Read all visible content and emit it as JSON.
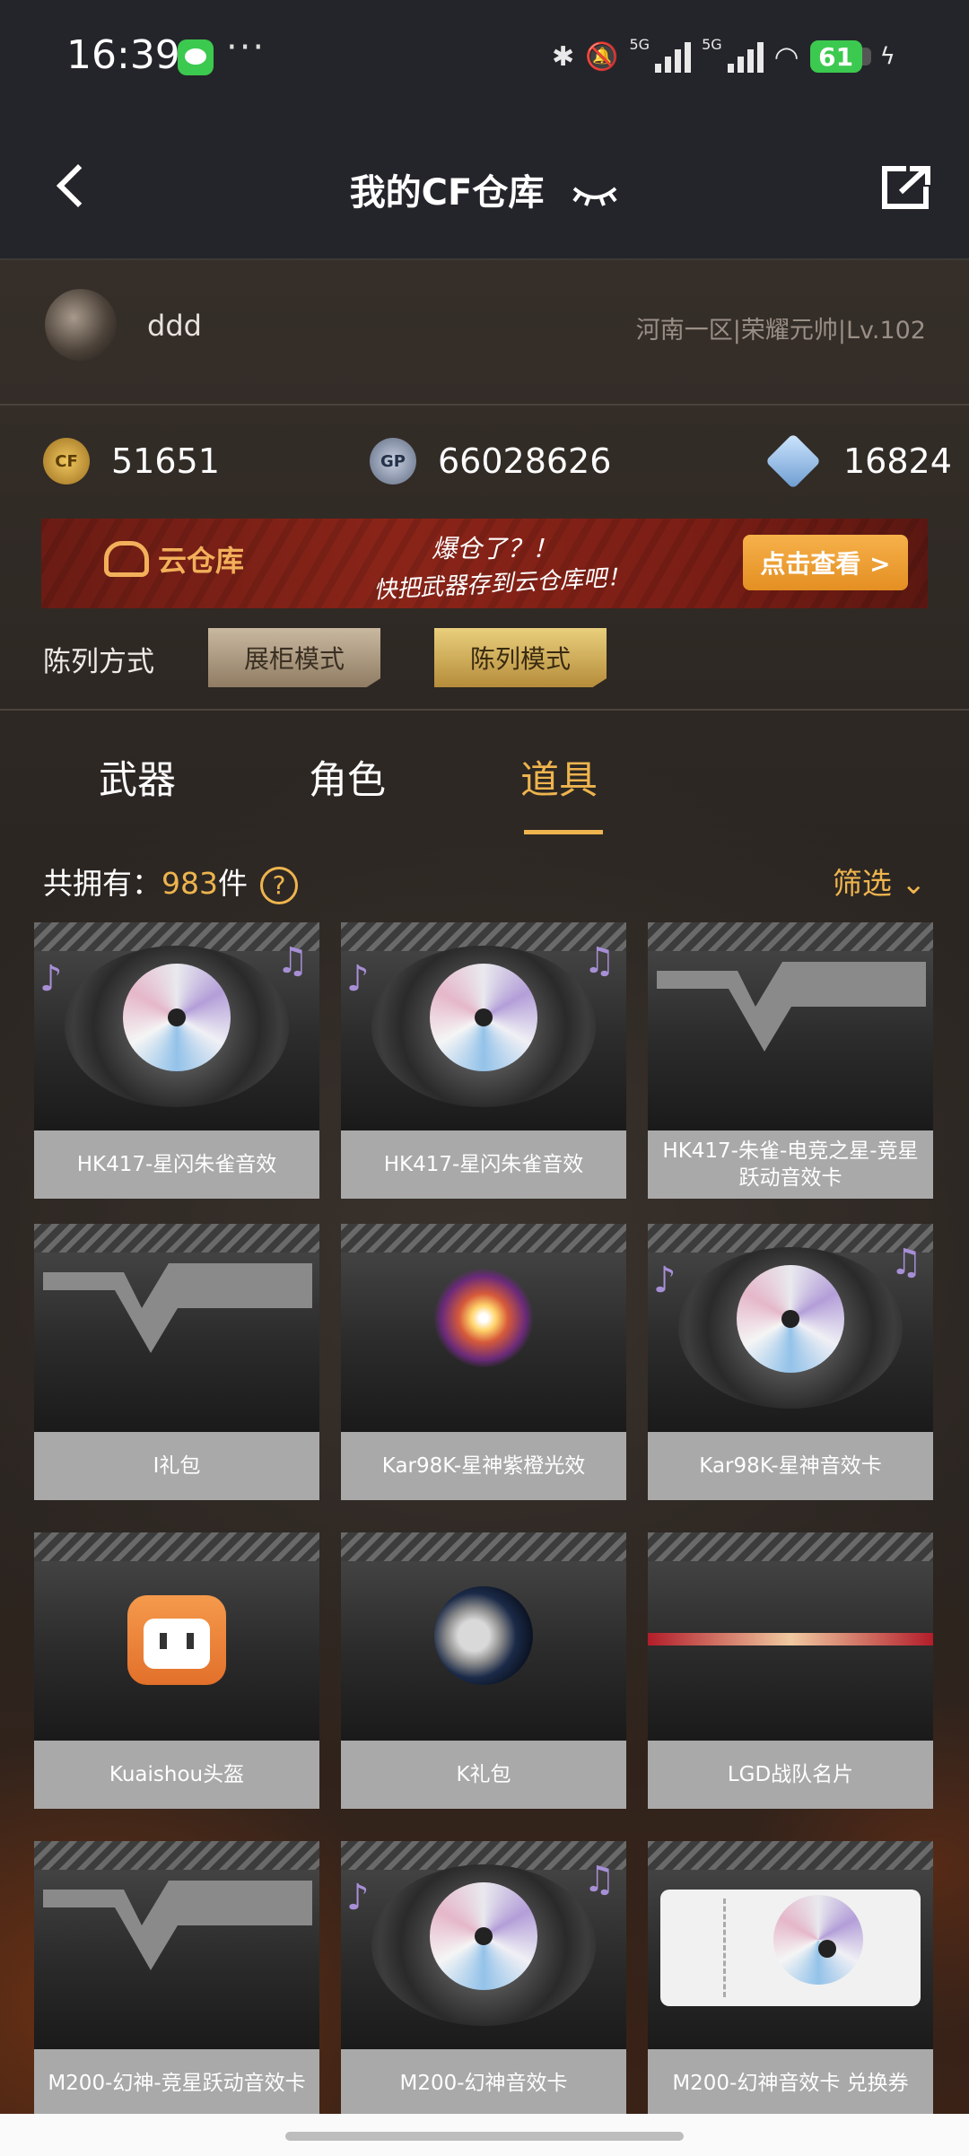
{
  "status_bar": {
    "time": "16:39",
    "more": "···",
    "net1": "5G",
    "net2": "5G",
    "battery": "61"
  },
  "header": {
    "title": "我的CF仓库"
  },
  "user": {
    "name": "ddd",
    "server_info": "河南一区|荣耀元帅|Lv.102"
  },
  "currency": {
    "cf_points": "51651",
    "gp": "66028626",
    "diamonds": "16824",
    "cf_icon": "CF",
    "gp_icon": "GP"
  },
  "banner": {
    "cloud_label": "云仓库",
    "slogan_line1": "爆仓了？！",
    "slogan_line2": "快把武器存到云仓库吧！",
    "button": "点击查看 >"
  },
  "layout": {
    "label": "陈列方式",
    "mode_cabinet": "展柜模式",
    "mode_display": "陈列模式"
  },
  "tabs": [
    {
      "label": "武器"
    },
    {
      "label": "角色"
    },
    {
      "label": "道具"
    }
  ],
  "summary": {
    "prefix": "共拥有：",
    "count": "983",
    "unit": "件",
    "help": "?",
    "filter": "筛选 ⌄"
  },
  "items": [
    {
      "name": "HK417-星闪朱雀音效"
    },
    {
      "name": "HK417-星闪朱雀音效"
    },
    {
      "name": "HK417-朱雀-电竞之星-竞星跃动音效卡"
    },
    {
      "name": "I礼包"
    },
    {
      "name": "Kar98K-星神紫橙光效"
    },
    {
      "name": "Kar98K-星神音效卡"
    },
    {
      "name": "Kuaishou头盔"
    },
    {
      "name": "K礼包"
    },
    {
      "name": "LGD战队名片"
    },
    {
      "name": "M200-幻神-竞星跃动音效卡"
    },
    {
      "name": "M200-幻神音效卡"
    },
    {
      "name": "M200-幻神音效卡 兑换券"
    }
  ]
}
